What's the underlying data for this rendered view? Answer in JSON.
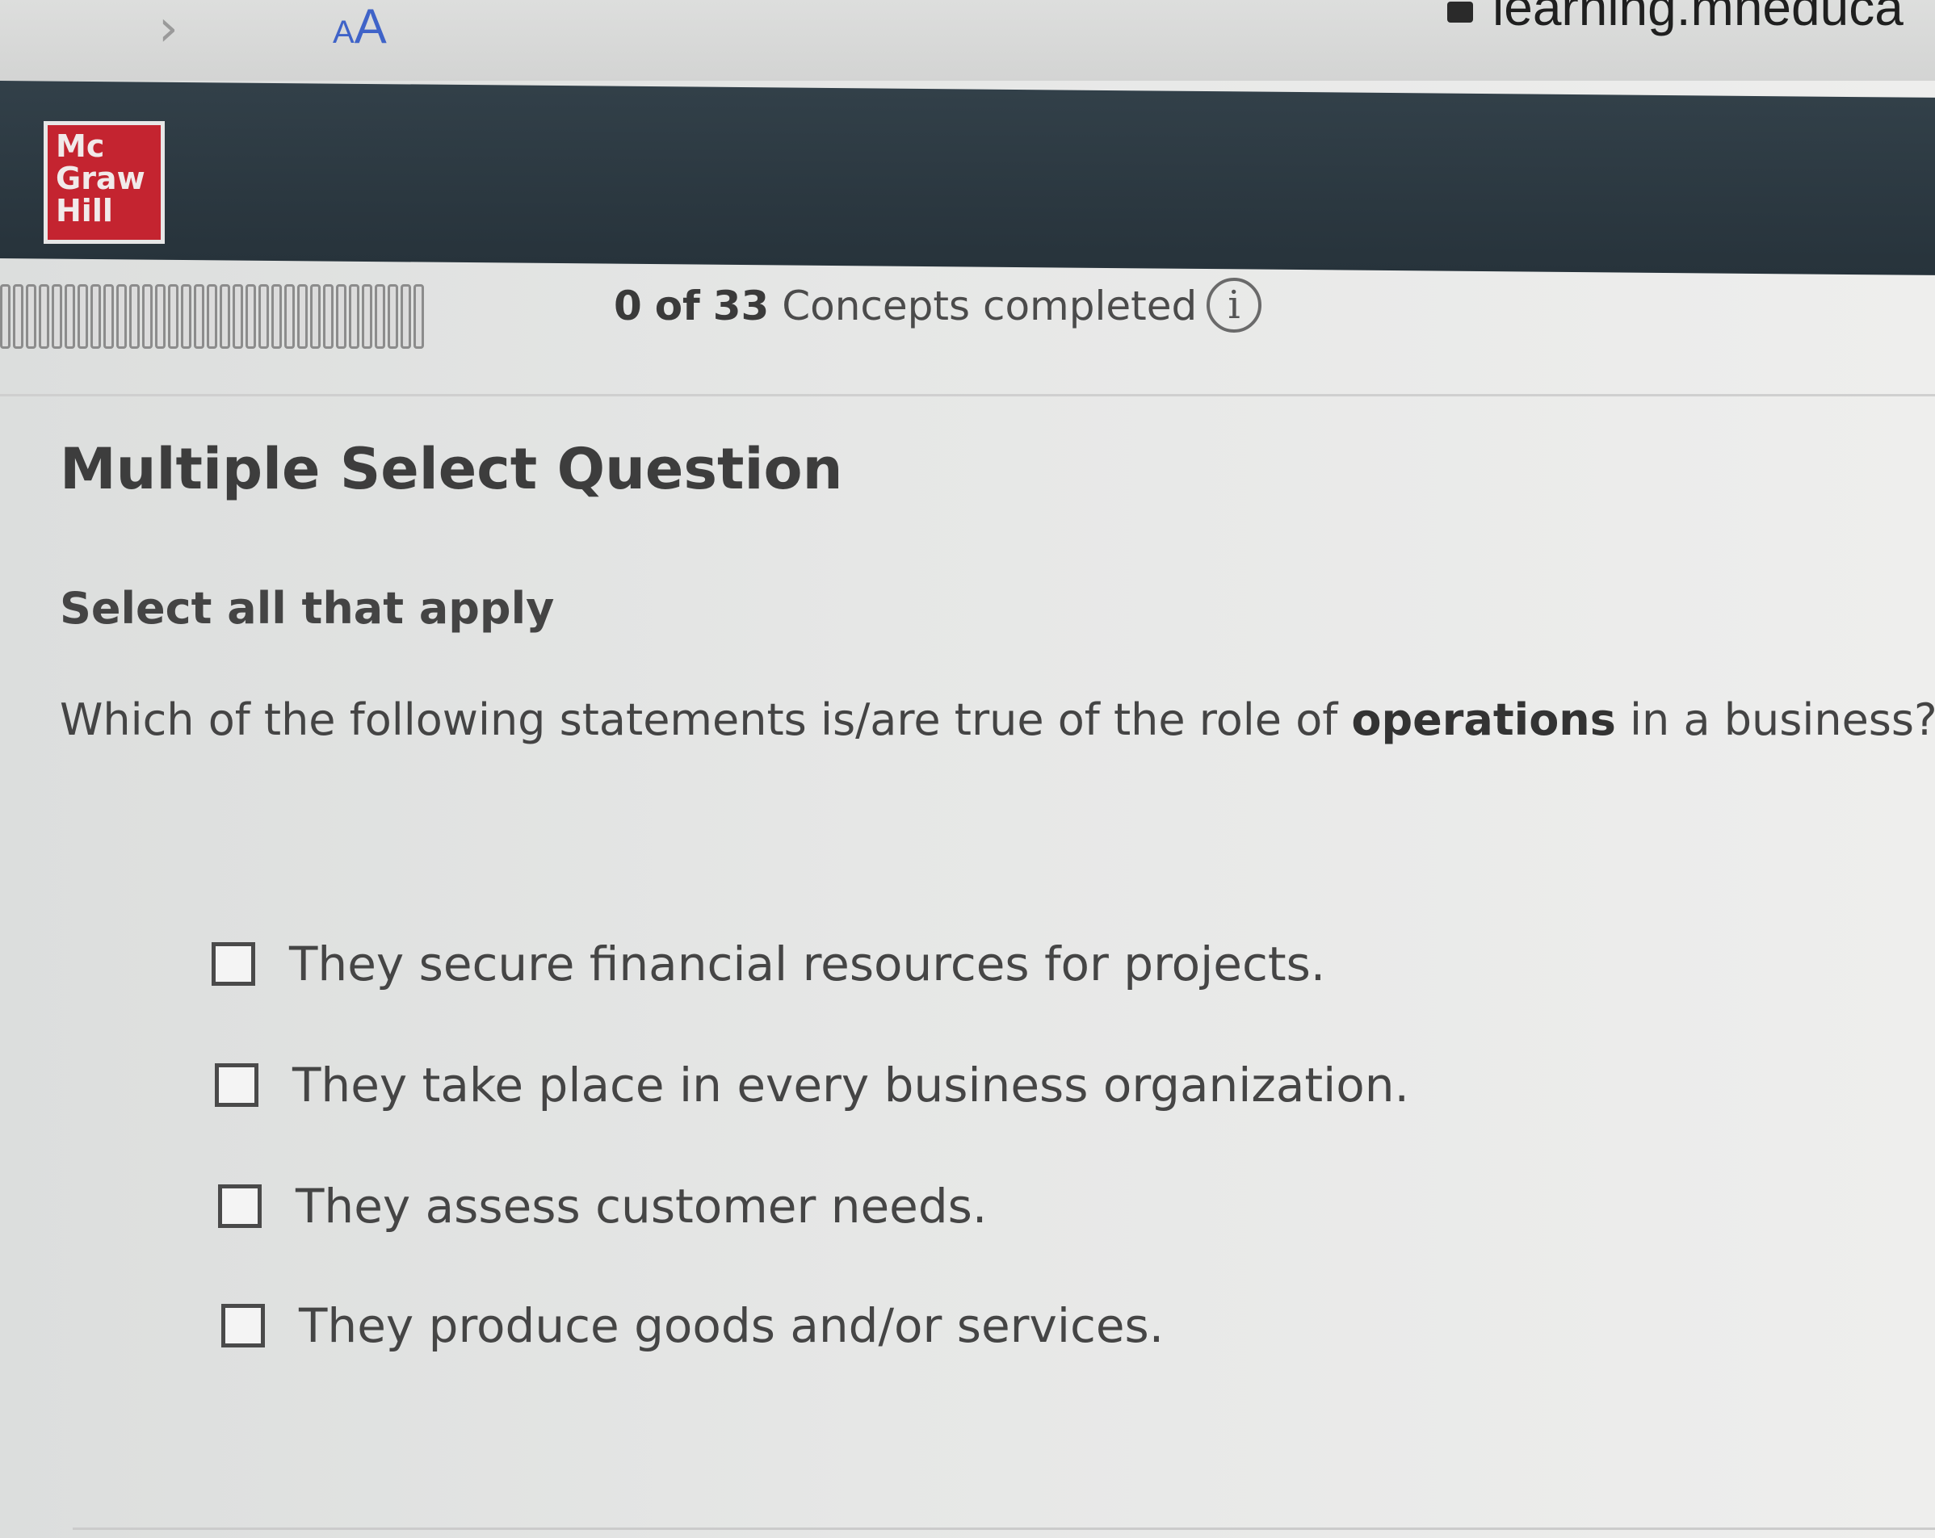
{
  "browser": {
    "forward_glyph": "›",
    "text_size_small": "A",
    "text_size_big": "A",
    "url": "learning.mheduca"
  },
  "header": {
    "logo_lines": [
      "Mc",
      "Graw",
      "Hill"
    ]
  },
  "progress": {
    "completed": "0",
    "of_label": "of",
    "total": "33",
    "label_suffix": "Concepts completed",
    "info_glyph": "i"
  },
  "question": {
    "type": "Multiple Select Question",
    "instruction": "Select all that apply",
    "prompt_before": "Which of the following statements is/are true of the role of ",
    "prompt_bold": "operations",
    "prompt_after": " in a business?",
    "options": [
      {
        "label": "They secure financial resources for projects.",
        "checked": false
      },
      {
        "label": "They take place in every business organization.",
        "checked": false
      },
      {
        "label": "They assess customer needs.",
        "checked": false
      },
      {
        "label": "They produce goods and/or services.",
        "checked": false
      }
    ]
  },
  "colors": {
    "header_bg": "#2b3840",
    "logo_red": "#c42430",
    "accent_blue": "#3f63c8"
  }
}
